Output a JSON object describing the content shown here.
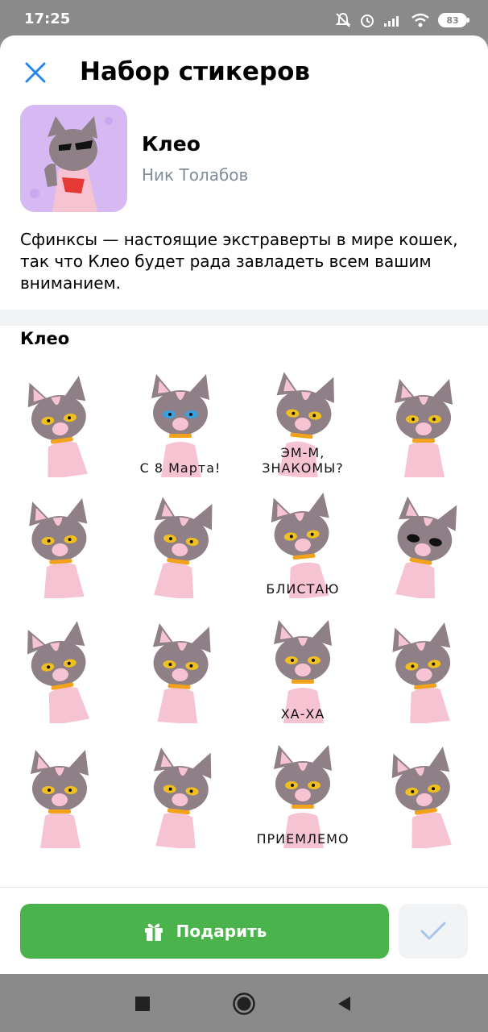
{
  "status_bar": {
    "time": "17:25",
    "battery": "83"
  },
  "header": {
    "title": "Набор стикеров",
    "close_icon": "close-icon"
  },
  "pack": {
    "name": "Клео",
    "author": "Ник Толабов",
    "description": "Сфинксы — настоящие экстраверты в мире кошек, так что Клео будет рада завладеть всем вашим вниманием."
  },
  "section": {
    "title": "Клео"
  },
  "stickers": [
    {
      "caption": ""
    },
    {
      "caption": "С 8 Марта!"
    },
    {
      "caption": "ЭМ-М, ЗНАКОМЫ?"
    },
    {
      "caption": ""
    },
    {
      "caption": ""
    },
    {
      "caption": ""
    },
    {
      "caption": "БЛИСТАЮ"
    },
    {
      "caption": ""
    },
    {
      "caption": ""
    },
    {
      "caption": ""
    },
    {
      "caption": "ХА-ХА"
    },
    {
      "caption": ""
    },
    {
      "caption": ""
    },
    {
      "caption": ""
    },
    {
      "caption": "ПРИЕМЛЕМО"
    },
    {
      "caption": ""
    }
  ],
  "footer": {
    "gift_label": "Подарить",
    "gift_icon": "gift-icon",
    "added_icon": "checkmark-icon"
  },
  "colors": {
    "accent": "#2688eb",
    "gift_button": "#4bb34b",
    "secondary_text": "#818c99",
    "cat_body": "#8f7f86",
    "cat_pink": "#f6c3d2"
  }
}
